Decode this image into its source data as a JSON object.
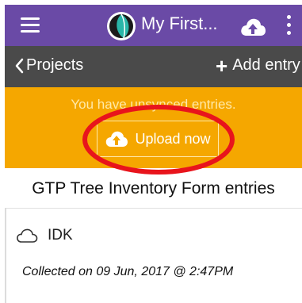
{
  "appbar": {
    "title": "My First...",
    "menu_icon": "hamburger-menu-icon",
    "logo": "app-logo",
    "upload_icon": "cloud-upload-icon",
    "more_icon": "more-vertical-icon"
  },
  "subnav": {
    "back_label": "Projects",
    "add_label": "Add entry"
  },
  "banner": {
    "message": "You have unsynced entries.",
    "button_label": "Upload now",
    "color": "#f5a700"
  },
  "section": {
    "title": "GTP Tree Inventory Form entries"
  },
  "entries": [
    {
      "name": "IDK",
      "collected": "Collected on 09 Jun, 2017 @ 2:47PM",
      "status_icon": "cloud-outline-icon"
    }
  ],
  "colors": {
    "appbar": "#6a4aa6",
    "subnav": "#4a4a4a",
    "annotation": "#e8141c"
  }
}
